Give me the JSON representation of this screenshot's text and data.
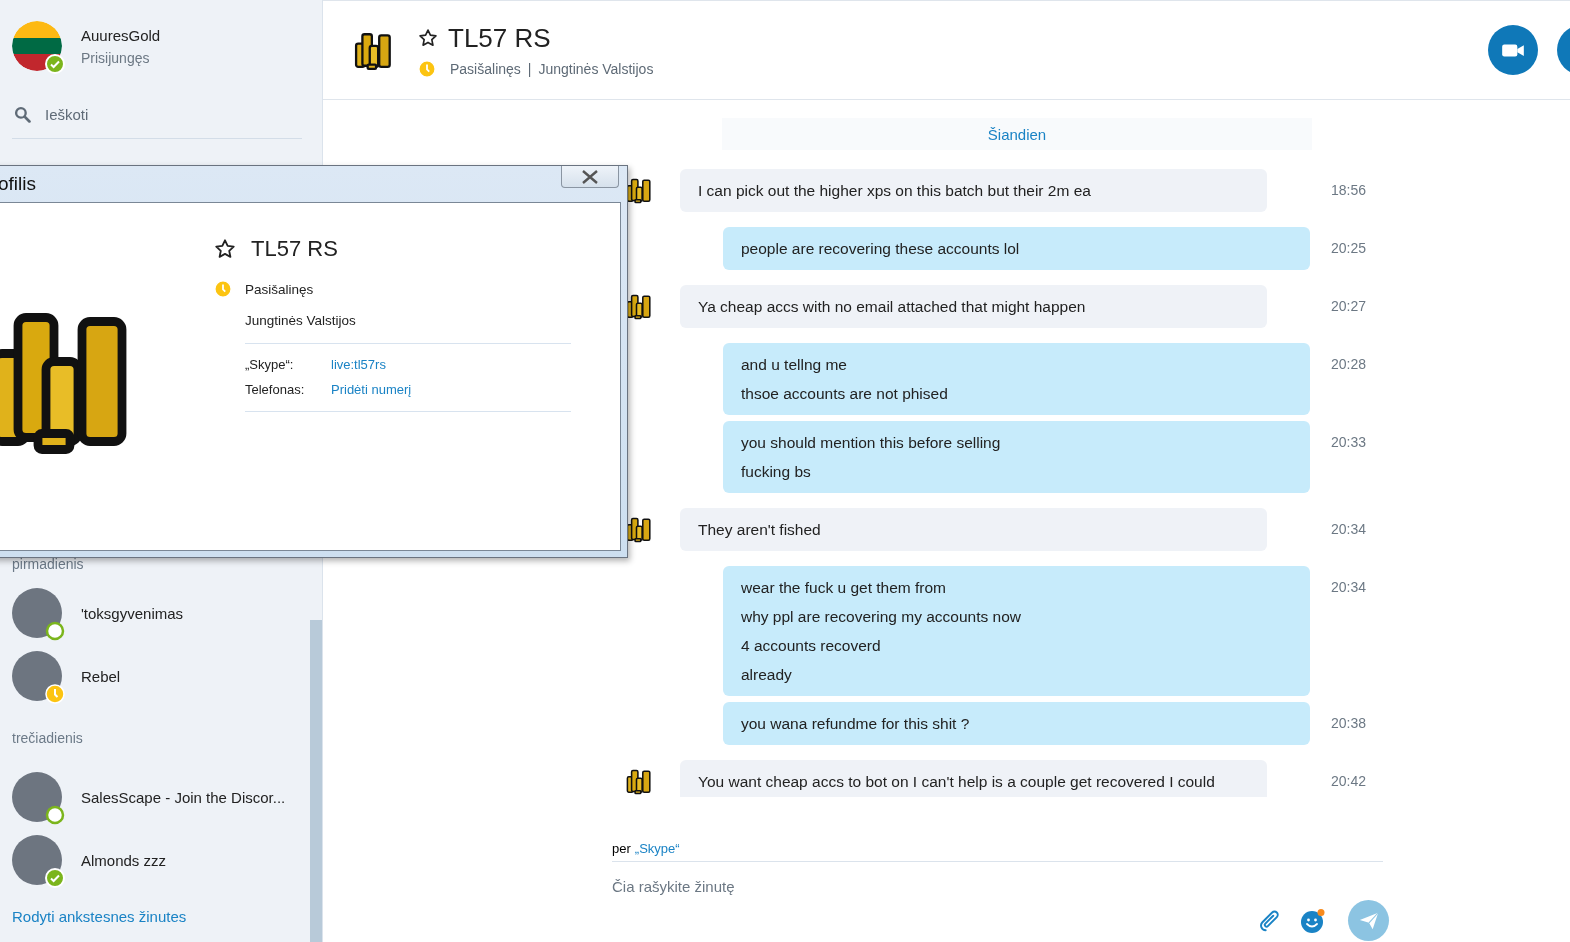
{
  "account": {
    "name": "AuuresGold",
    "status": "Prisijungęs",
    "kind": "online-check"
  },
  "search": {
    "placeholder": "Ieškoti"
  },
  "recent": [
    {
      "group": "pirmadienis",
      "contacts": [
        {
          "name": "'toksgyvenimas",
          "kind": "online-ring",
          "selected": false
        },
        {
          "name": "Rebel",
          "kind": "away",
          "selected": false
        }
      ]
    },
    {
      "group": "trečiadienis",
      "contacts": [
        {
          "name": "SalesScape - Join the Discor...",
          "kind": "online-ring",
          "selected": false
        },
        {
          "name": "Almonds zzz",
          "kind": "online-check",
          "selected": false
        }
      ]
    }
  ],
  "show_older": "Rodyti ankstesnes žinutes",
  "conversation": {
    "name": "TL57 RS",
    "favorite": false,
    "kind": "away",
    "status": "Pasišalinęs",
    "separator": "|",
    "location": "Jungtinės Valstijos"
  },
  "date_divider": "Šiandien",
  "messages": [
    {
      "kind": "incoming",
      "lines": [
        "I can pick out the higher xps on this batch but their 2m ea"
      ],
      "time": "18:56"
    },
    {
      "kind": "outgoing",
      "lines": [
        "people are recovering these accounts lol"
      ],
      "time": "20:25"
    },
    {
      "kind": "incoming",
      "lines": [
        "Ya cheap accs with no email attached that might happen"
      ],
      "time": "20:27"
    },
    {
      "kind": "outgoing",
      "lines": [
        "and u tellng me",
        "thsoe accounts are not phised"
      ],
      "time": "20:28"
    },
    {
      "kind": "outgoing",
      "lines": [
        "you should mention this before selling",
        "fucking bs"
      ],
      "time": "20:33"
    },
    {
      "kind": "incoming",
      "lines": [
        "They aren't fished"
      ],
      "time": "20:34"
    },
    {
      "kind": "outgoing",
      "lines": [
        "wear the fuck u get them from",
        "why ppl are recovering my accounts now",
        "4 accounts recoverd",
        "already"
      ],
      "time": "20:34"
    },
    {
      "kind": "outgoing",
      "lines": [
        "you wana refundme for this shit ?"
      ],
      "time": "20:38"
    },
    {
      "kind": "incoming",
      "lines": [
        "You want cheap accs to bot on I can't help is a couple get recovered I could"
      ],
      "time": "20:42"
    }
  ],
  "compose": {
    "via": "per",
    "service": "„Skype“",
    "placeholder": "Čia rašykite žinutę",
    "emoji_notification": true
  },
  "profile_window": {
    "title": "ofilis",
    "name": "TL57 RS",
    "favorite": false,
    "kind": "away",
    "status": "Pasišalinęs",
    "location": "Jungtinės Valstijos",
    "fields": [
      {
        "label": "„Skype“:",
        "value": "live:tl57rs"
      },
      {
        "label": "Telefonas:",
        "value": "Pridėti numerį"
      }
    ]
  }
}
